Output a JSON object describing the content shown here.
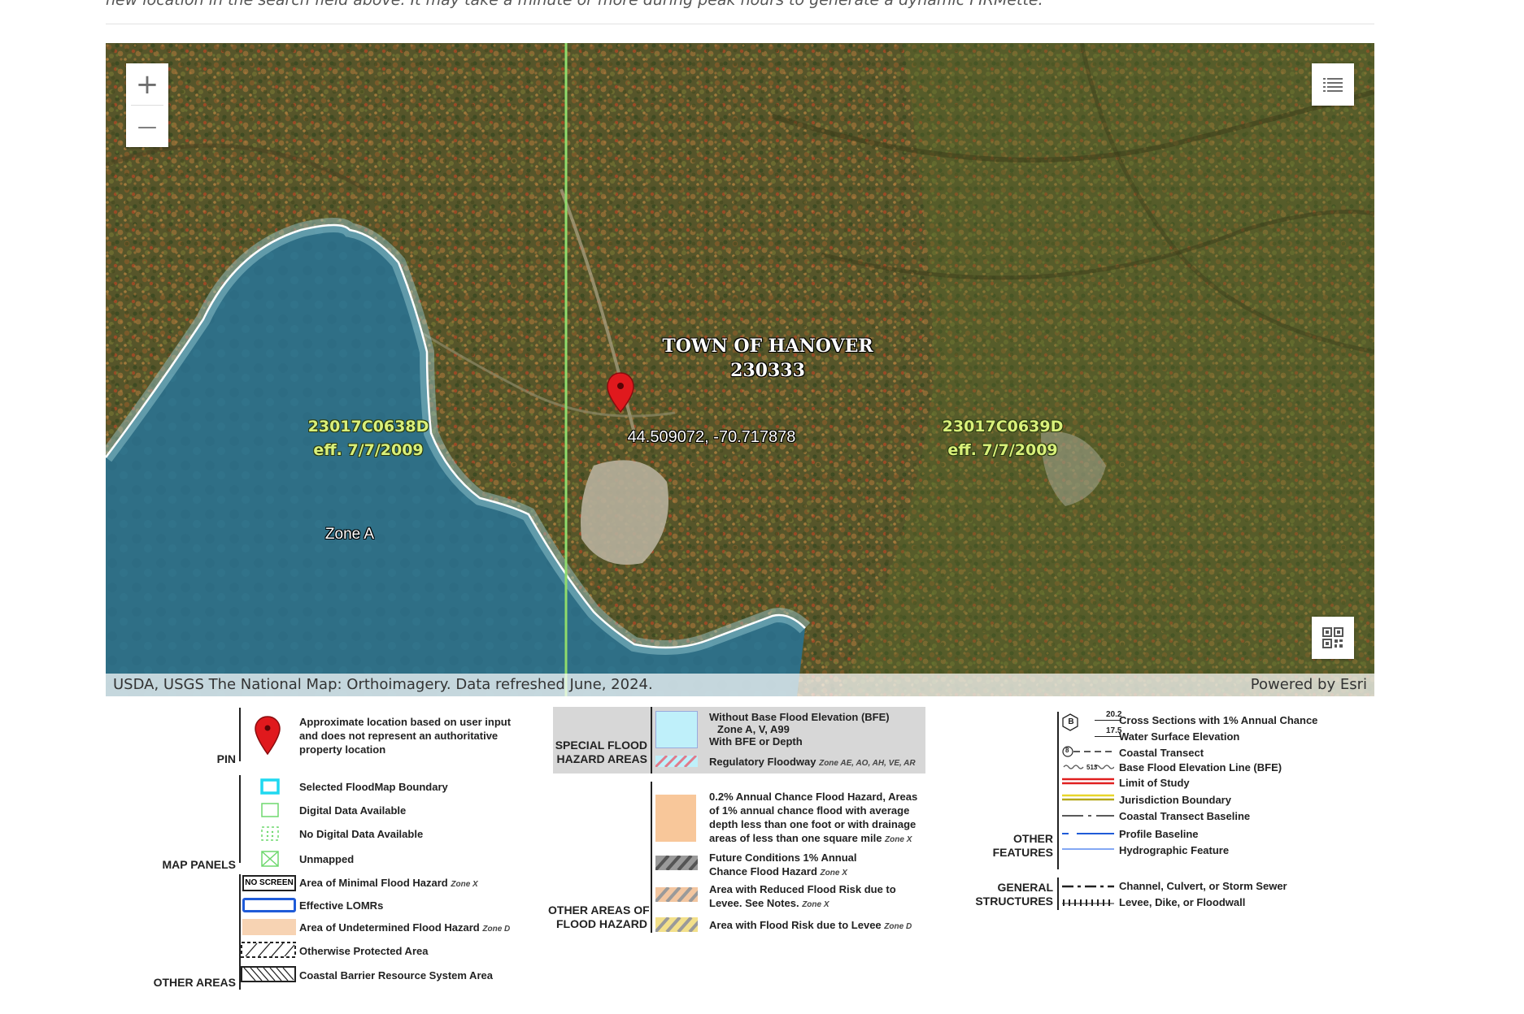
{
  "intro": {
    "text": "new location in the search field above. It may take a minute or more during peak hours to generate a dynamic FIRMette."
  },
  "map": {
    "town_label_line1": "TOWN OF HANOVER",
    "town_label_line2": "230333",
    "panel_west_id": "23017C0638D",
    "panel_west_eff": "eff. 7/7/2009",
    "panel_east_id": "23017C0639D",
    "panel_east_eff": "eff. 7/7/2009",
    "coordinates": "44.509072, -70.717878",
    "zone_label": "Zone A",
    "controls": {
      "zoom_in": "+",
      "zoom_out": "—",
      "layers_icon": "list-icon",
      "qr_icon": "qr-code-icon"
    },
    "attribution": "USDA, USGS The National Map: Orthoimagery. Data refreshed June, 2024.",
    "powered_by": "Powered by Esri",
    "colors": {
      "water": "#2f6f86",
      "forest": "#5b5a2c",
      "boundary_line": "#8fdc6c",
      "panel_label": "#d9f07a",
      "pin": "#e0191d"
    }
  },
  "legend": {
    "pin": {
      "category": "PIN",
      "text_line1": "Approximate location based on user input",
      "text_line2": "and does not represent an authoritative",
      "text_line3": "property location"
    },
    "map_panels": {
      "category": "MAP PANELS",
      "items": [
        "Selected FloodMap Boundary",
        "Digital Data Available",
        "No Digital Data Available",
        "Unmapped"
      ]
    },
    "other_areas": {
      "category": "OTHER AREAS",
      "items": [
        {
          "label": "Area of Minimal Flood Hazard",
          "zone": "Zone X",
          "swatch_text": "NO SCREEN"
        },
        {
          "label": "Effective LOMRs",
          "zone": ""
        },
        {
          "label": "Area of Undetermined Flood Hazard",
          "zone": "Zone D"
        },
        {
          "label": "Otherwise Protected Area",
          "zone": ""
        },
        {
          "label": "Coastal Barrier Resource System Area",
          "zone": ""
        }
      ]
    },
    "sfha": {
      "category_line1": "SPECIAL FLOOD",
      "category_line2": "HAZARD AREAS",
      "item1_line1": "Without Base Flood Elevation (BFE)",
      "item1_zone": "Zone A, V, A99",
      "item2_line1": "With BFE or Depth",
      "item3_line1": "Regulatory Floodway",
      "item3_zone": "Zone AE, AO, AH, VE, AR"
    },
    "other_flood": {
      "category_line1": "OTHER AREAS OF",
      "category_line2": "FLOOD HAZARD",
      "item1_line1": "0.2% Annual Chance Flood Hazard, Areas",
      "item1_line2": "of 1% annual chance flood with average",
      "item1_line3": "depth less than one foot or with drainage",
      "item1_line4": "areas of less than one square mile",
      "item1_zone": "Zone X",
      "item2_line1": "Future Conditions 1% Annual",
      "item2_line2": "Chance Flood Hazard",
      "item2_zone": "Zone X",
      "item3_line1": "Area with Reduced Flood Risk due to",
      "item3_line2": "Levee. See Notes.",
      "item3_zone": "Zone X",
      "item4_line1": "Area with Flood Risk due to Levee",
      "item4_zone": "Zone D"
    },
    "other_features": {
      "category_line1": "OTHER",
      "category_line2": "FEATURES",
      "xs_letter": "B",
      "xs_value": "20.2",
      "wse_value": "17.5",
      "transect_num": "8",
      "bfe_value": "513",
      "items": [
        "Cross Sections with 1% Annual Chance",
        "Water Surface Elevation",
        "Coastal Transect",
        "Base Flood Elevation Line (BFE)",
        "Limit of Study",
        "Jurisdiction Boundary",
        "Coastal Transect Baseline",
        "Profile Baseline",
        "Hydrographic Feature"
      ]
    },
    "general_structures": {
      "category_line1": "GENERAL",
      "category_line2": "STRUCTURES",
      "items": [
        "Channel, Culvert, or Storm Sewer",
        "Levee, Dike, or Floodwall"
      ]
    }
  }
}
